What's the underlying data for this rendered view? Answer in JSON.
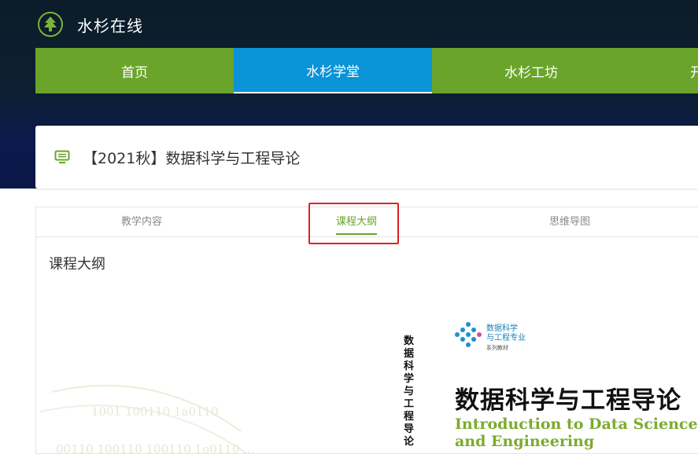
{
  "brand": {
    "name": "水杉在线",
    "logo_icon": "tree-icon"
  },
  "nav": {
    "items": [
      {
        "label": "首页",
        "active": false
      },
      {
        "label": "水杉学堂",
        "active": true
      },
      {
        "label": "水杉工坊",
        "active": false
      },
      {
        "label": "开",
        "active": false
      }
    ]
  },
  "course": {
    "icon": "chalkboard-icon",
    "title": "【2021秋】数据科学与工程导论"
  },
  "tabs": [
    {
      "label": "教学内容",
      "active": false
    },
    {
      "label": "课程大纲",
      "active": true
    },
    {
      "label": "思维导图",
      "active": false
    }
  ],
  "section": {
    "title": "课程大纲"
  },
  "cover": {
    "spine_text": "数据科学与工程导论",
    "series_line1": "数据科学",
    "series_line2": "与工程专业",
    "series_line3": "系列教材",
    "title_cn": "数据科学与工程导论",
    "title_en_line1": "Introduction to Data Science",
    "title_en_line2": "and Engineering",
    "binary_line1": "1001 100110 1a0110",
    "binary_line2": "00110 100110 100110 1o0110 ..."
  },
  "colors": {
    "green": "#6aa42b",
    "blue": "#0a93d6",
    "red_box": "#e02020",
    "dark": "#0c1c2a"
  }
}
